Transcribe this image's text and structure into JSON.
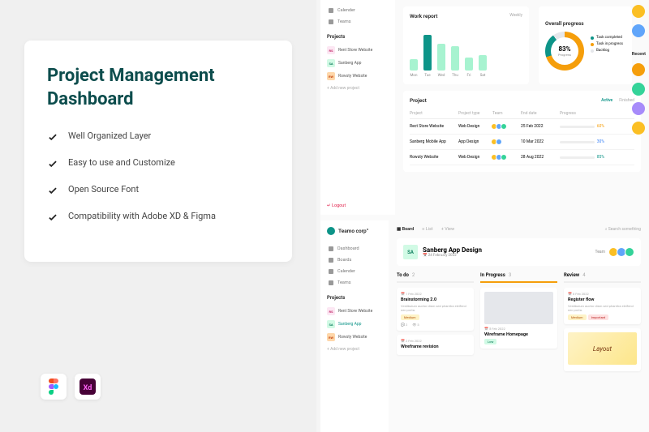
{
  "promo": {
    "title": "Project Management Dashboard",
    "features": [
      "Well Organized Layer",
      "Easy to use and Customize",
      "Open Source Font",
      "Compatibility with Adobe XD & Figma"
    ]
  },
  "dash1": {
    "nav": [
      "Calender",
      "Teams"
    ],
    "projects_label": "Projects",
    "projects": [
      {
        "badge": "RS",
        "name": "Rent Store Website"
      },
      {
        "badge": "SA",
        "name": "Sanberg App"
      },
      {
        "badge": "RW",
        "name": "Rowsty Website"
      }
    ],
    "add_project": "+  Add new project",
    "logout": "Logout",
    "work_report": {
      "title": "Work report",
      "scope": "Weekly",
      "days": [
        "Mon",
        "Tue",
        "Wed",
        "Thu",
        "Fri",
        "Sat"
      ]
    },
    "overall": {
      "title": "Overall progress",
      "pct": "83%",
      "sub": "Progress",
      "legend": [
        {
          "label": "Task completed",
          "color": "#0d9488"
        },
        {
          "label": "Task in progress",
          "color": "#f59e0b"
        },
        {
          "label": "Backlog",
          "color": "#e5e7eb"
        }
      ]
    },
    "recent": "Recent",
    "table": {
      "title": "Project",
      "tabs": [
        "Active",
        "Finished"
      ],
      "headers": [
        "Project",
        "Project type",
        "Team",
        "End date",
        "Progress"
      ],
      "rows": [
        {
          "name": "Rect Store Website",
          "type": "Web Design",
          "date": "25 Feb 2022",
          "pct": 60,
          "color": "#f59e0b"
        },
        {
          "name": "Sanberg Mobile App",
          "type": "App Design",
          "date": "10 Mar 2022",
          "pct": 30,
          "color": "#3b82f6"
        },
        {
          "name": "Rowsty Website",
          "type": "Web Design",
          "date": "28 Aug 2022",
          "pct": 85,
          "color": "#0d9488"
        }
      ]
    }
  },
  "dash2": {
    "brand": "Teamo corp°",
    "nav": [
      "Dashboard",
      "Boards",
      "Calender",
      "Teams"
    ],
    "projects_label": "Projects",
    "projects": [
      {
        "badge": "RS",
        "name": "Rent Store Website"
      },
      {
        "badge": "SA",
        "name": "Sanberg App",
        "active": true
      },
      {
        "badge": "RW",
        "name": "Rowsty Website"
      }
    ],
    "add_project": "+  Add new project",
    "topbar": {
      "board": "Board",
      "list": "List",
      "view": "View",
      "search": "Search something"
    },
    "header": {
      "badge": "SA",
      "title": "Sanberg App Design",
      "date": "24 February 2022",
      "team": "Team"
    },
    "columns": [
      {
        "name": "To do",
        "count": 2
      },
      {
        "name": "In Progress",
        "count": 3
      },
      {
        "name": "Review",
        "count": 4
      }
    ],
    "tasks": {
      "todo": [
        {
          "date": "1 Feb 2022",
          "title": "Brainstorming 2.0",
          "desc": "Vestibulum auctor diam sed pharetra eleifend nec porta.",
          "tag": "Medium",
          "c": "2",
          "v": "3"
        },
        {
          "date": "2 Feb 2022",
          "title": "Wireframe revision"
        }
      ],
      "progress": [
        {
          "date": "5 Feb 2022",
          "title": "Wireframe Homepage",
          "tag": "Low"
        }
      ],
      "review": [
        {
          "date": "8 Feb 2022",
          "title": "Register flow",
          "desc": "Vestibulum auctor diam sed pharetra eleifend nec porta.",
          "tags": [
            "Medium",
            "Important"
          ]
        }
      ]
    }
  },
  "chart_data": {
    "type": "bar",
    "title": "Work report",
    "categories": [
      "Mon",
      "Tue",
      "Wed",
      "Thu",
      "Fri",
      "Sat"
    ],
    "values": [
      40,
      95,
      75,
      70,
      45,
      50
    ],
    "ylim": [
      0,
      120
    ],
    "xlabel": "",
    "ylabel": ""
  }
}
